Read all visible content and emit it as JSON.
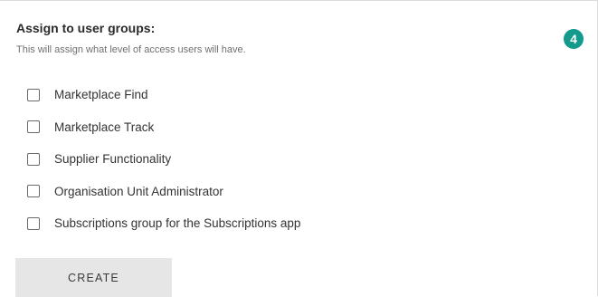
{
  "section": {
    "heading": "Assign to user groups:",
    "subtext": "This will assign what level of access users will have.",
    "step_number": "4",
    "accent_color": "#129a8c"
  },
  "groups": [
    {
      "label": "Marketplace Find",
      "checked": false
    },
    {
      "label": "Marketplace Track",
      "checked": false
    },
    {
      "label": "Supplier Functionality",
      "checked": false
    },
    {
      "label": "Organisation Unit Administrator",
      "checked": false
    },
    {
      "label": "Subscriptions group for the Subscriptions app",
      "checked": false
    }
  ],
  "actions": {
    "create_label": "CREATE"
  }
}
